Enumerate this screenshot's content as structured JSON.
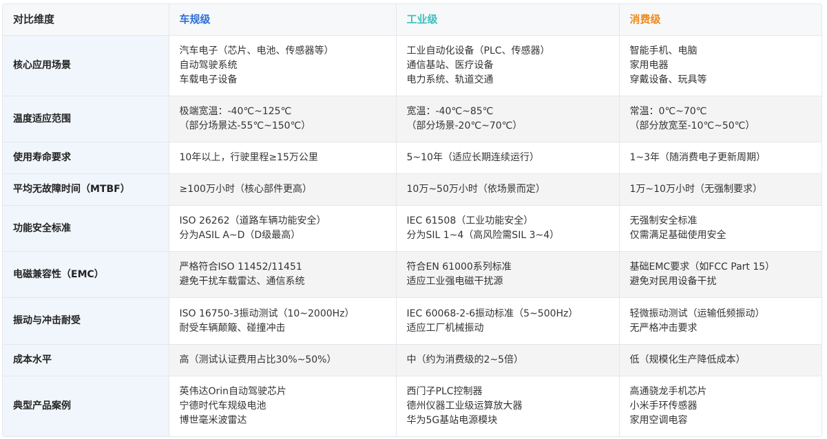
{
  "colors": {
    "automotive": "#2f6fd6",
    "industrial": "#3bbfc0",
    "consumer": "#ef8a1a",
    "dimension_bg": "#f1f6fc",
    "header_bg": "#f6f8fa",
    "alt_row_bg": "#f4f4f4"
  },
  "headers": {
    "dimension": "对比维度",
    "automotive": "车规级",
    "industrial": "工业级",
    "consumer": "消费级"
  },
  "rows": [
    {
      "dimension": "核心应用场景",
      "automotive": [
        "汽车电子（芯片、电池、传感器等）",
        "自动驾驶系统",
        "车载电子设备"
      ],
      "industrial": [
        "工业自动化设备（PLC、传感器）",
        "通信基站、医疗设备",
        "电力系统、轨道交通"
      ],
      "consumer": [
        "智能手机、电脑",
        "家用电器",
        "穿戴设备、玩具等"
      ]
    },
    {
      "dimension": "温度适应范围",
      "automotive": [
        "极端宽温：-40℃~125℃",
        "（部分场景达-55℃~150℃）"
      ],
      "industrial": [
        "宽温：-40℃~85℃",
        "（部分场景-20℃~70℃）"
      ],
      "consumer": [
        "常温：0℃~70℃",
        "（部分放宽至-10℃~50℃）"
      ]
    },
    {
      "dimension": "使用寿命要求",
      "automotive": [
        "10年以上，行驶里程≥15万公里"
      ],
      "industrial": [
        "5~10年（适应长期连续运行）"
      ],
      "consumer": [
        "1~3年（随消费电子更新周期）"
      ]
    },
    {
      "dimension": "平均无故障时间（MTBF）",
      "automotive": [
        "≥100万小时（核心部件更高）"
      ],
      "industrial": [
        "10万~50万小时（依场景而定）"
      ],
      "consumer": [
        "1万~10万小时（无强制要求）"
      ]
    },
    {
      "dimension": "功能安全标准",
      "automotive": [
        "ISO 26262（道路车辆功能安全）",
        "分为ASIL A~D（D级最高）"
      ],
      "industrial": [
        "IEC 61508（工业功能安全）",
        "分为SIL 1~4（高风险需SIL 3~4）"
      ],
      "consumer": [
        "无强制安全标准",
        "仅需满足基础使用安全"
      ]
    },
    {
      "dimension": "电磁兼容性（EMC）",
      "automotive": [
        "严格符合ISO 11452/11451",
        "避免干扰车载雷达、通信系统"
      ],
      "industrial": [
        "符合EN 61000系列标准",
        "适应工业强电磁干扰源"
      ],
      "consumer": [
        "基础EMC要求（如FCC Part 15）",
        "避免对民用设备干扰"
      ]
    },
    {
      "dimension": "振动与冲击耐受",
      "automotive": [
        "ISO 16750-3振动测试（10~2000Hz）",
        "耐受车辆颠簸、碰撞冲击"
      ],
      "industrial": [
        "IEC 60068-2-6振动标准（5~500Hz）",
        "适应工厂机械振动"
      ],
      "consumer": [
        "轻微振动测试（运输低频振动）",
        "无严格冲击要求"
      ]
    },
    {
      "dimension": "成本水平",
      "automotive": [
        "高（测试认证费用占比30%~50%）"
      ],
      "industrial": [
        "中（约为消费级的2~5倍）"
      ],
      "consumer": [
        "低（规模化生产降低成本）"
      ]
    },
    {
      "dimension": "典型产品案例",
      "automotive": [
        "英伟达Orin自动驾驶芯片",
        "宁德时代车规级电池",
        "博世毫米波雷达"
      ],
      "industrial": [
        "西门子PLC控制器",
        "德州仪器工业级运算放大器",
        "华为5G基站电源模块"
      ],
      "consumer": [
        "高通骁龙手机芯片",
        "小米手环传感器",
        "家用空调电容"
      ]
    }
  ]
}
